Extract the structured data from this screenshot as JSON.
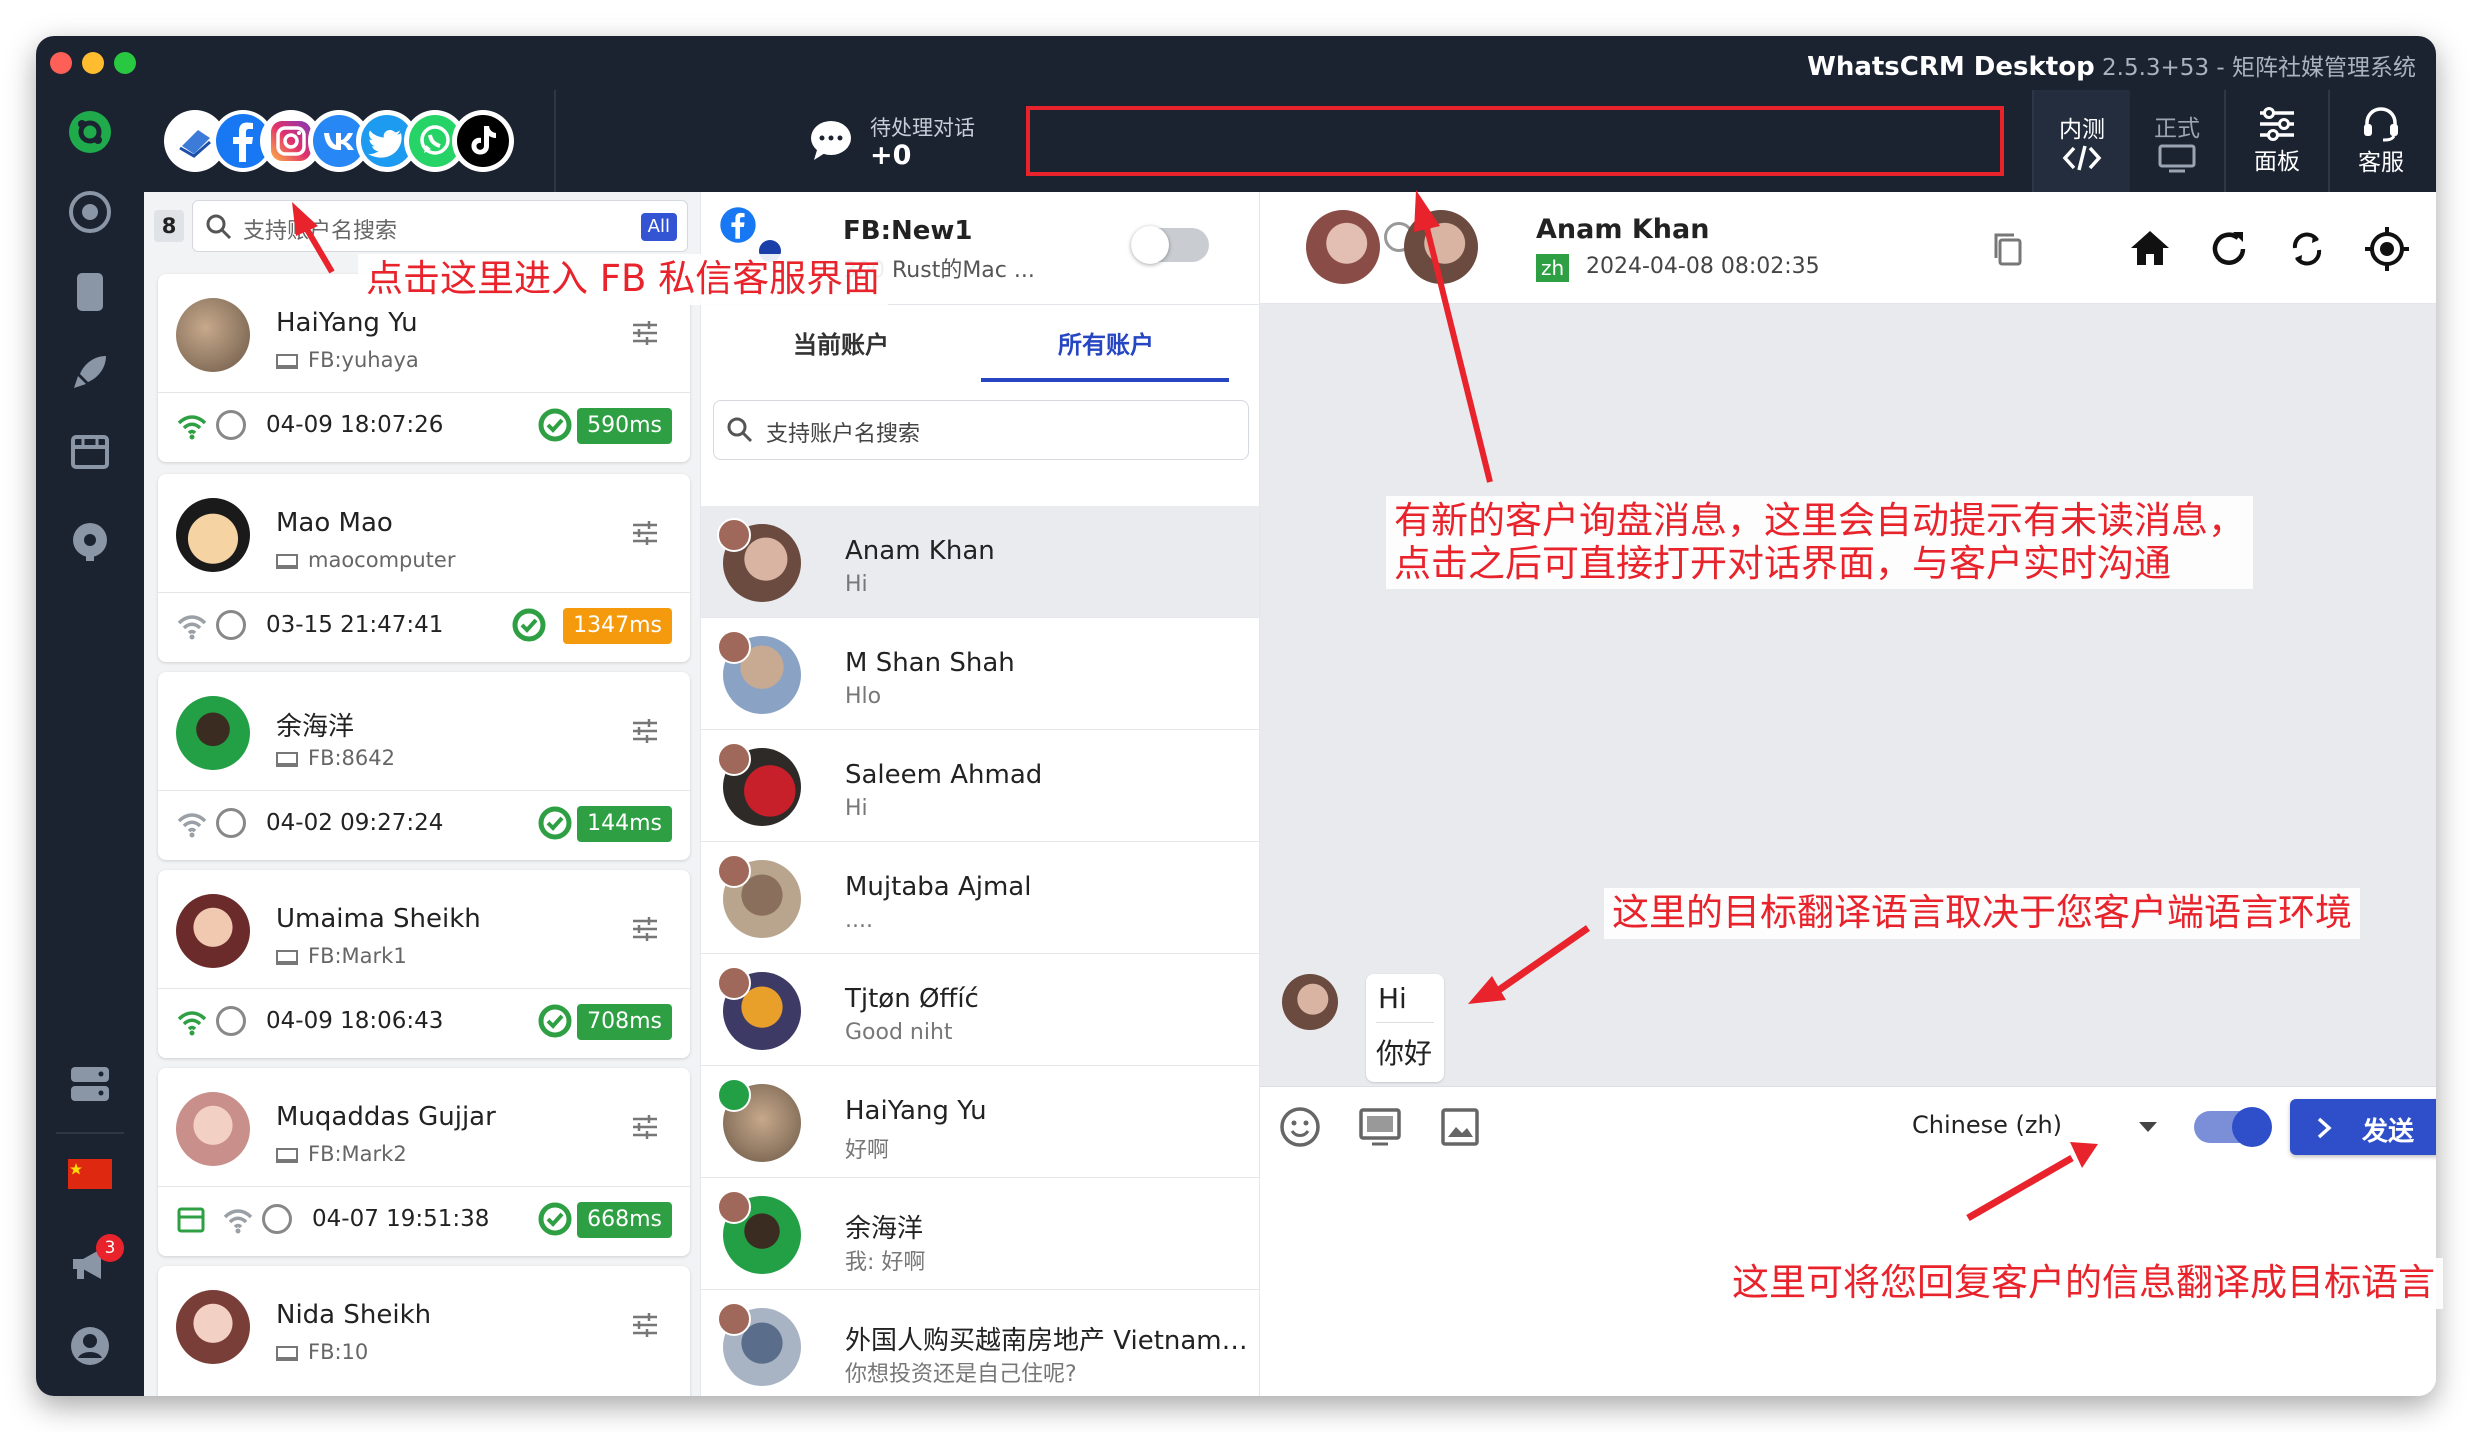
{
  "window": {
    "title_main": "WhatsCRM Desktop",
    "title_sub": " 2.5.3+53 - 矩阵社媒管理系统"
  },
  "top_bar": {
    "social_icons": [
      "desktop-app-icon",
      "facebook-icon",
      "instagram-icon",
      "vk-icon",
      "twitter-icon",
      "whatsapp-icon",
      "tiktok-icon"
    ],
    "pending_label": "待处理对话",
    "pending_count": "+0",
    "buttons": [
      {
        "label": "内测",
        "icon": "code-icon"
      },
      {
        "label": "正式",
        "icon": "screen-icon"
      },
      {
        "label": "面板",
        "icon": "sliders-icon"
      },
      {
        "label": "客服",
        "icon": "headset-icon"
      }
    ]
  },
  "left_bar": {
    "icons": [
      "app-logo-icon",
      "chrome-icon",
      "phone-icon",
      "rocket-icon",
      "store-icon",
      "settings-user-icon",
      "server-icon",
      "china-flag-icon",
      "megaphone-icon",
      "user-icon"
    ],
    "megaphone_badge": "3"
  },
  "accounts": {
    "count": "8",
    "search_placeholder": "支持账户名搜索",
    "filter_badge": "All",
    "items": [
      {
        "name": "HaiYang Yu",
        "sub": "FB:yuhaya",
        "time": "04-09 18:07:26",
        "ms": "590ms",
        "ms_color": "#2ea043",
        "online": true
      },
      {
        "name": "Mao  Mao",
        "sub": "maocomputer",
        "time": "03-15 21:47:41",
        "ms": "1347ms",
        "ms_color": "#f59a0c",
        "online": false
      },
      {
        "name": "余海洋",
        "sub": "FB:8642",
        "time": "04-02 09:27:24",
        "ms": "144ms",
        "ms_color": "#2ea043",
        "online": false
      },
      {
        "name": "Umaima Sheikh",
        "sub": "FB:Mark1",
        "time": "04-09 18:06:43",
        "ms": "708ms",
        "ms_color": "#2ea043",
        "online": true
      },
      {
        "name": "Muqaddas Gujjar",
        "sub": "FB:Mark2",
        "time": "04-07 19:51:38",
        "ms": "668ms",
        "ms_color": "#2ea043",
        "online": false
      },
      {
        "name": "Nida Sheikh",
        "sub": "FB:10",
        "time": "",
        "ms": "",
        "ms_color": "#2ea043",
        "online": false
      }
    ]
  },
  "conversations": {
    "account_title": "FB:New1",
    "account_sub": "300  Rust的Mac ...",
    "tab_current": "当前账户",
    "tab_all": "所有账户",
    "search_placeholder": "支持账户名搜索",
    "items": [
      {
        "name": "Anam Khan",
        "msg": "Hi"
      },
      {
        "name": "M Shan Shah",
        "msg": "Hlo"
      },
      {
        "name": "Saleem Ahmad",
        "msg": "Hi"
      },
      {
        "name": "Mujtaba Ajmal",
        "msg": "...."
      },
      {
        "name": "Tjtøn  Øffíć",
        "msg": "Good niht"
      },
      {
        "name": "HaiYang Yu",
        "msg": "好啊"
      },
      {
        "name": "余海洋",
        "msg": "我: 好啊"
      },
      {
        "name": "外国人购买越南房地产 Vietnam…",
        "msg": "你想投资还是自己住呢?"
      }
    ]
  },
  "chat": {
    "contact_name": "Anam Khan",
    "lang_badge": "zh",
    "timestamp": "2024-04-08 08:02:35",
    "message_original": "Hi",
    "message_translated": "你好",
    "language_select": "Chinese (zh)",
    "send_label": "发送"
  },
  "annotations": {
    "note_fb": "点击这里进入 FB 私信客服界面",
    "note_unread_line1": "有新的客户询盘消息，这里会自动提示有未读消息，",
    "note_unread_line2": "点击之后可直接打开对话界面，与客户实时沟通",
    "note_target_lang": "这里的目标翻译语言取决于您客户端语言环境",
    "note_reply_translate": "这里可将您回复客户的信息翻译成目标语言"
  }
}
